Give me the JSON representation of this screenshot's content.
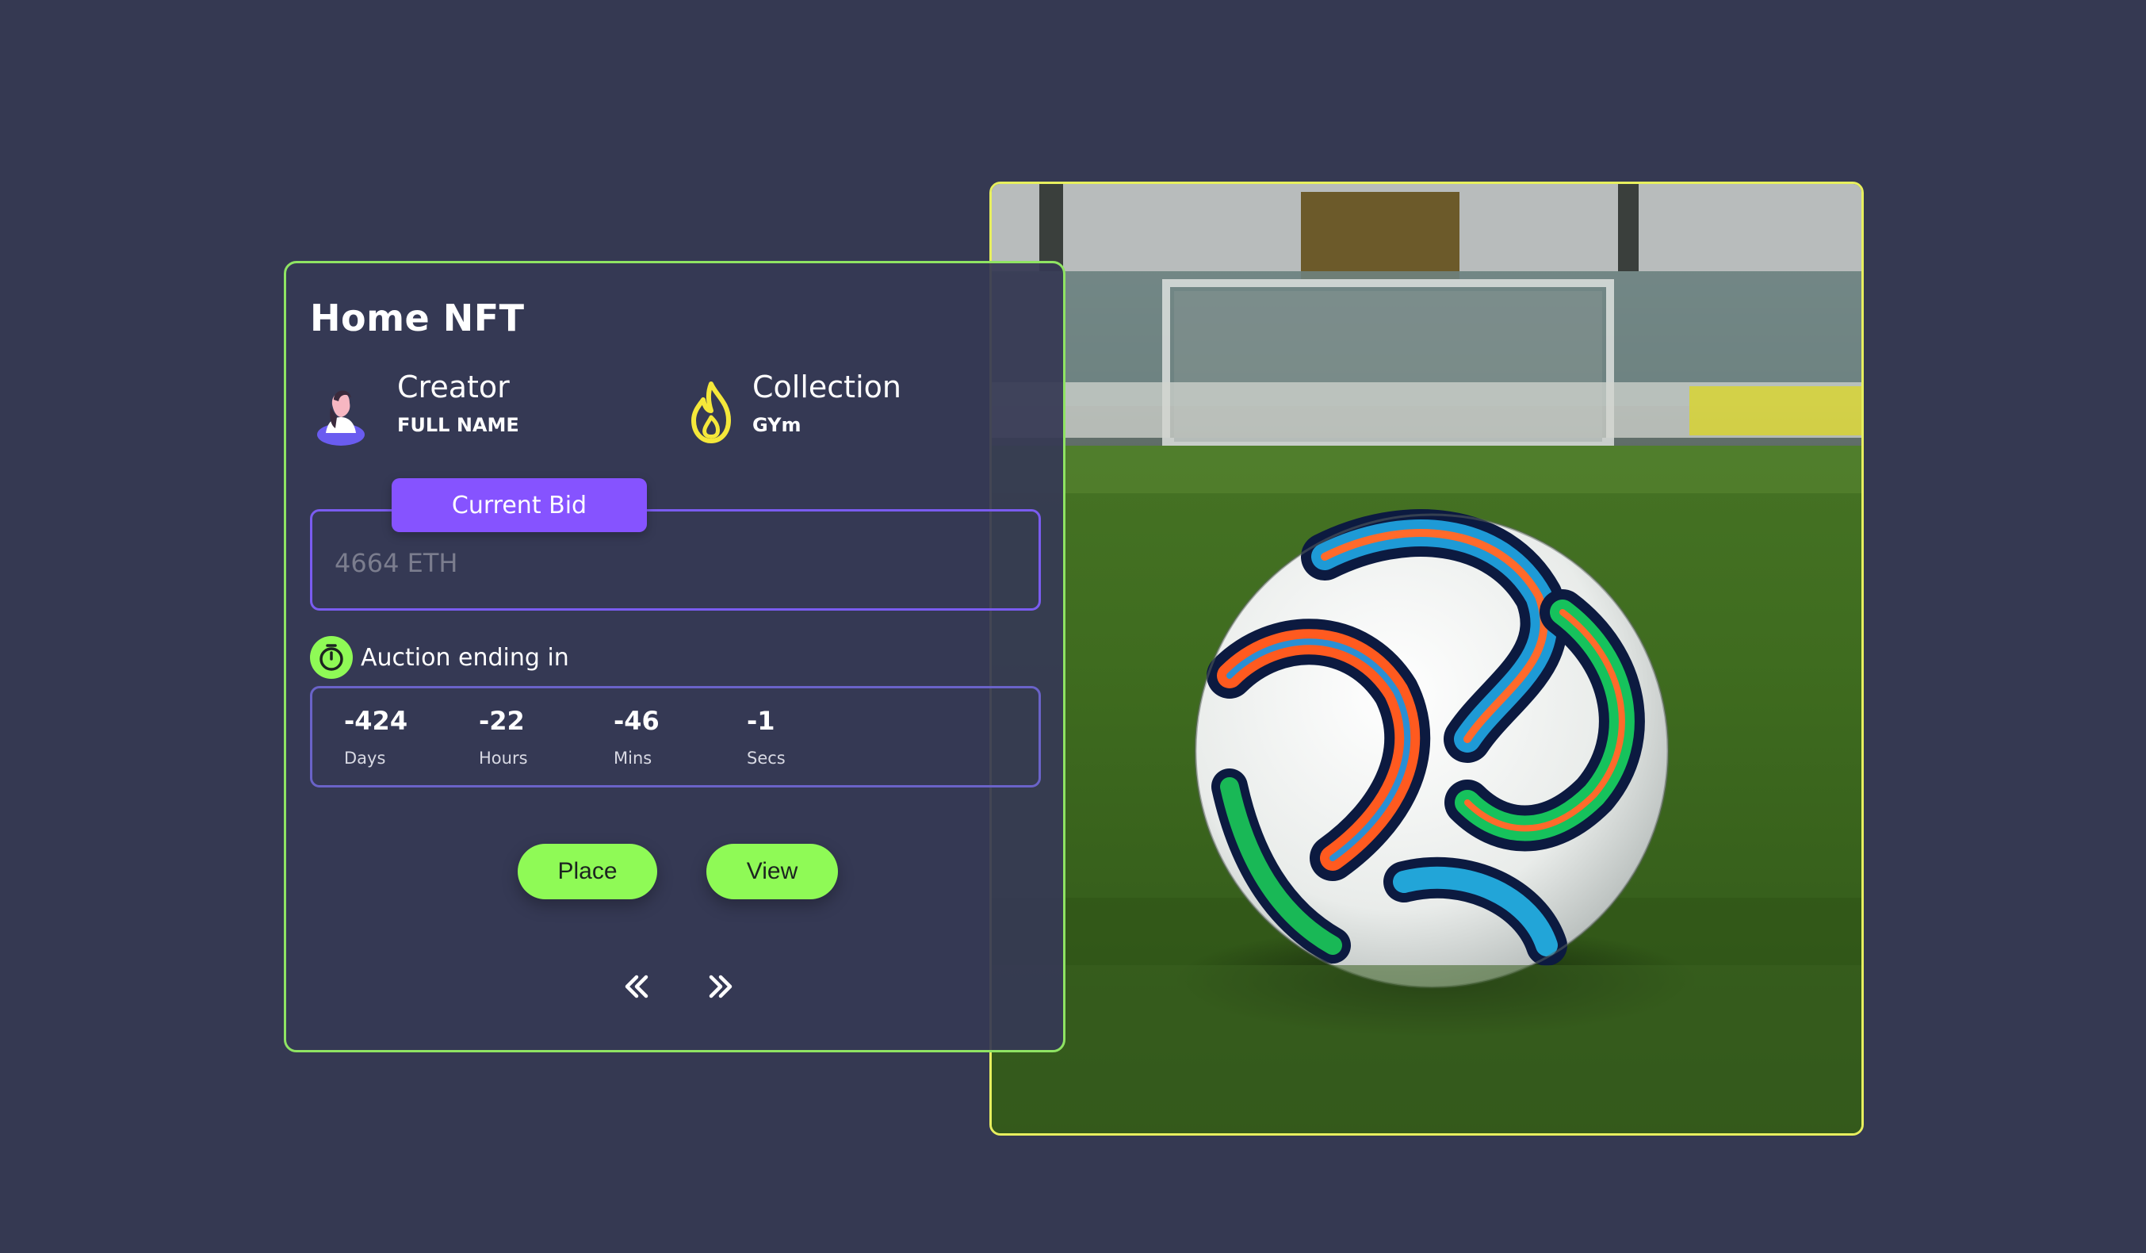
{
  "card": {
    "title": "Home NFT",
    "creator": {
      "label": "Creator",
      "value": "FULL NAME",
      "icon": "person-avatar-icon"
    },
    "collection": {
      "label": "Collection",
      "value": "GYm",
      "icon": "flame-icon"
    },
    "bid": {
      "tab_label": "Current Bid",
      "value": "4664 ETH"
    },
    "auction": {
      "label": "Auction ending in",
      "icon": "stopwatch-icon",
      "units": [
        {
          "value": "-424",
          "label": "Days"
        },
        {
          "value": "-22",
          "label": "Hours"
        },
        {
          "value": "-46",
          "label": "Mins"
        },
        {
          "value": "-1",
          "label": "Secs"
        }
      ]
    },
    "buttons": {
      "place": "Place",
      "view": "View"
    },
    "nav": {
      "prev_icon": "double-chevron-left-icon",
      "next_icon": "double-chevron-right-icon"
    }
  },
  "image": {
    "subject": "soccer-ball-on-grass"
  },
  "colors": {
    "background": "#353952",
    "card_border": "#8fe463",
    "image_border": "#e7ef5e",
    "accent_purple": "#8653ff",
    "button_green": "#8ffa56",
    "flame_yellow": "#f5e83a"
  }
}
